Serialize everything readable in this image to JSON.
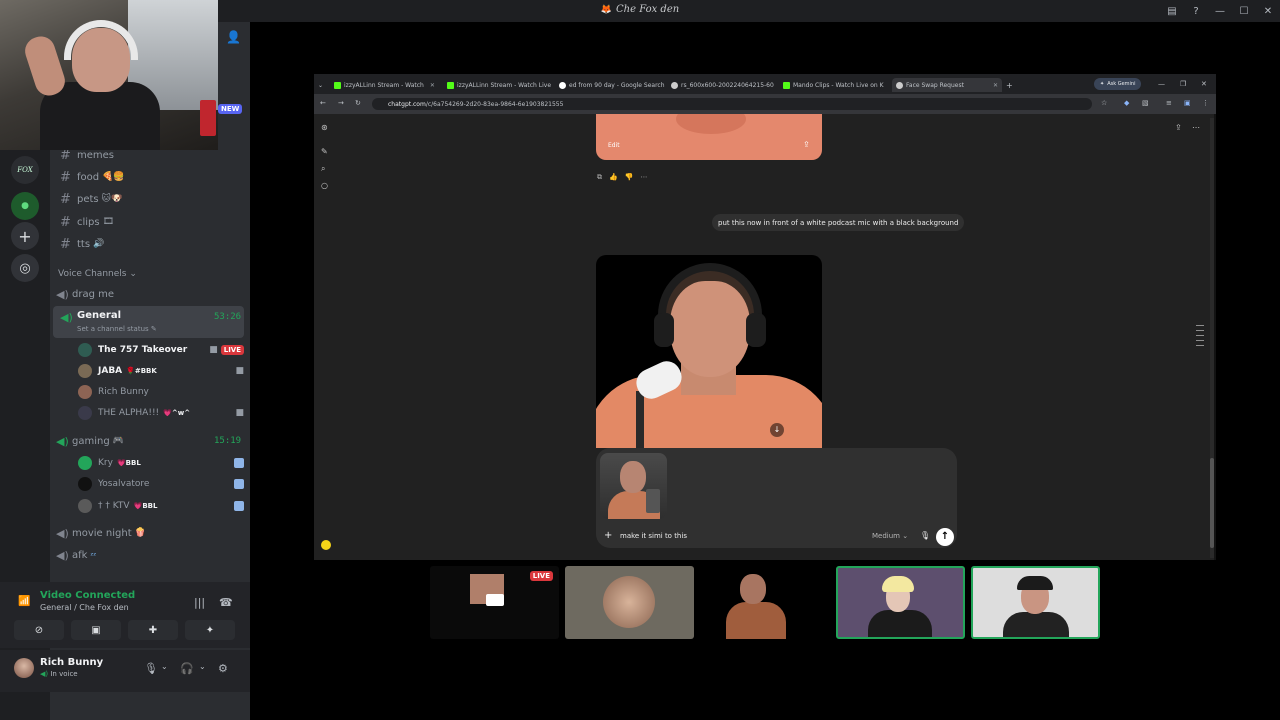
{
  "window": {
    "title": "Che Fox den",
    "title_icon": "fox-icon"
  },
  "channels": {
    "text": [
      {
        "name": "memes",
        "emoji": ""
      },
      {
        "name": "food",
        "emoji": "🍕🍔"
      },
      {
        "name": "pets",
        "emoji": "🐱🐶"
      },
      {
        "name": "clips",
        "emoji": "🎞"
      },
      {
        "name": "tts",
        "emoji": "🔊"
      }
    ],
    "voice_category": "Voice Channels",
    "voice": {
      "drag_me": "drag me",
      "general": {
        "name": "General",
        "status": "Set a channel status",
        "time": "53:26",
        "users": [
          {
            "name": "The 757 Takeover",
            "tag": "",
            "badge": "LIVE",
            "bold": true,
            "avatar_color": "#2f5c52"
          },
          {
            "name": "JABA",
            "tag": "#BBK",
            "badge": "",
            "bold": true,
            "avatar_color": "#7a6a55"
          },
          {
            "name": "Rich Bunny",
            "tag": "",
            "badge": "",
            "bold": false,
            "avatar_color": "#8d6454"
          },
          {
            "name": "THE ALPHA!!!",
            "tag": "^w^",
            "badge": "",
            "bold": false,
            "avatar_color": "#3a3a4a"
          }
        ]
      },
      "gaming": {
        "name": "gaming",
        "time": "15:19",
        "users": [
          {
            "name": "Kry",
            "tag": "BBL",
            "avatar_color": "#23a55a"
          },
          {
            "name": "Yosalvatore",
            "tag": "",
            "avatar_color": "#111111"
          },
          {
            "name": "† † KTV",
            "tag": "BBL",
            "avatar_color": "#5a5a5a"
          }
        ]
      },
      "movie_night": "movie night",
      "afk": "afk"
    }
  },
  "voice_panel": {
    "status": "Video Connected",
    "channel": "General / Che Fox den"
  },
  "user": {
    "name": "Rich Bunny",
    "status": "In voice"
  },
  "browser": {
    "tabs": [
      {
        "title": "izzyALLinn Stream - Watch",
        "color": "#53fc18"
      },
      {
        "title": "izzyALLinn Stream - Watch Live",
        "color": "#53fc18"
      },
      {
        "title": "ed from 90 day - Google Search",
        "color": "#ffffff"
      },
      {
        "title": "rs_600x600-200224064215-60",
        "color": "#cccccc"
      },
      {
        "title": "Mando Clips - Watch Live on K",
        "color": "#53fc18"
      },
      {
        "title": "Face Swap Request",
        "color": "#cccccc"
      }
    ],
    "ask_gemini": "Ask Gemini",
    "url_domain": "chatgpt.com",
    "url_path": "/c/6a754269-2d20-83ea-9864-6e1903821555"
  },
  "chat": {
    "edit_label": "Edit",
    "user_message": "put this now in front of a white podcast mic with a black background",
    "composer_text": "make it simi to this",
    "model": "Medium"
  },
  "tiles": {
    "live_badge": "LIVE"
  }
}
